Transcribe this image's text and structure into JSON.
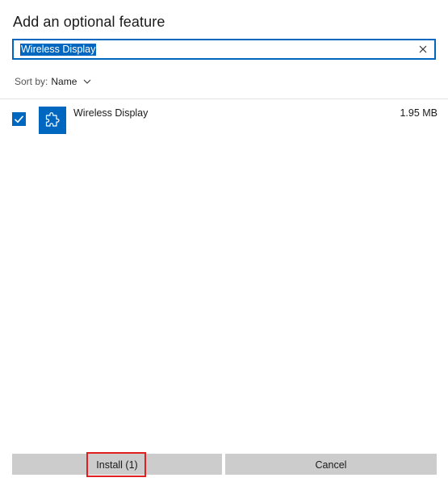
{
  "dialog": {
    "title": "Add an optional feature"
  },
  "search": {
    "value": "Wireless Display",
    "clear_icon": "close-icon"
  },
  "sort": {
    "label": "Sort by:",
    "value": "Name",
    "icon": "chevron-down-icon"
  },
  "features": [
    {
      "name": "Wireless Display",
      "size": "1.95 MB",
      "checked": true,
      "icon": "puzzle-piece-icon"
    }
  ],
  "footer": {
    "install_label": "Install (1)",
    "cancel_label": "Cancel"
  },
  "colors": {
    "accent": "#0067c0",
    "button_bg": "#cccccc",
    "highlight": "#e02020"
  }
}
